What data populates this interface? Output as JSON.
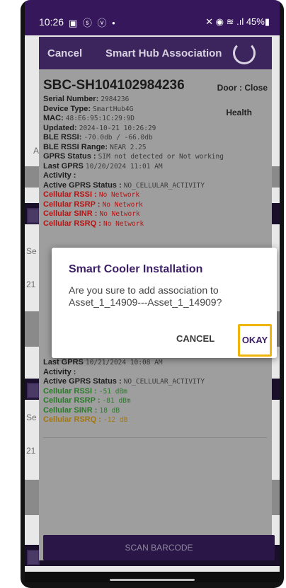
{
  "status_bar": {
    "time": "10:26",
    "notification_icons": "▣ ⓢ ⓥ •",
    "system_icons": "✕ ◉ ≋ .ıl 45%▮"
  },
  "header": {
    "cancel_label": "Cancel",
    "title": "Smart Hub Association"
  },
  "device": {
    "id": "SBC-SH104102984236",
    "door_status": "Door : Close",
    "health_label": "Health",
    "rows": [
      {
        "label": "Serial Number:",
        "value": "2984236",
        "tone": "normal"
      },
      {
        "label": "Device Type:",
        "value": "SmartHub4G",
        "tone": "normal"
      },
      {
        "label": "MAC:",
        "value": "48:E6:95:1C:29:9D",
        "tone": "normal"
      },
      {
        "label": "Updated:",
        "value": "2024-10-21 10:26:29",
        "tone": "normal"
      },
      {
        "label": "BLE RSSI:",
        "value": "-70.0db / -66.0db",
        "tone": "normal"
      },
      {
        "label": "BLE RSSI Range:",
        "value": "NEAR 2.25",
        "tone": "normal"
      },
      {
        "label": "GPRS Status :",
        "value": "SIM not detected or Not working",
        "tone": "normal"
      },
      {
        "label": "Last GPRS",
        "value": "10/20/2024 11:01 AM",
        "tone": "normal"
      },
      {
        "label": "Activity :",
        "value": "",
        "tone": "normal"
      },
      {
        "label": "Active GPRS Status :",
        "value": "NO_CELLULAR_ACTIVITY",
        "tone": "normal"
      },
      {
        "label": "Cellular RSSI :",
        "value": "No Network",
        "tone": "red"
      },
      {
        "label": "Cellular RSRP :",
        "value": "No Network",
        "tone": "red"
      },
      {
        "label": "Cellular SINR :",
        "value": "No Network",
        "tone": "red"
      },
      {
        "label": "Cellular RSRQ :",
        "value": "No Network",
        "tone": "red"
      }
    ]
  },
  "device2": {
    "rows": [
      {
        "label": "Last GPRS",
        "value": "10/21/2024 10:08 AM",
        "tone": "normal"
      },
      {
        "label": "Activity :",
        "value": "",
        "tone": "normal"
      },
      {
        "label": "Active GPRS Status :",
        "value": "NO_CELLULAR_ACTIVITY",
        "tone": "normal"
      },
      {
        "label": "Cellular RSSI :",
        "value": "-51 dBm",
        "tone": "green"
      },
      {
        "label": "Cellular RSRP :",
        "value": "-81 dBm",
        "tone": "green"
      },
      {
        "label": "Cellular SINR :",
        "value": "18 dB",
        "tone": "green"
      },
      {
        "label": "Cellular RSRQ :",
        "value": "-12 dB",
        "tone": "orange"
      }
    ]
  },
  "scan_button_label": "SCAN BARCODE",
  "dialog": {
    "title": "Smart Cooler Installation",
    "message": "Are you sure to add association to Asset_1_14909---Asset_1_14909?",
    "cancel_label": "CANCEL",
    "okay_label": "OKAY"
  },
  "background": {
    "partial_texts": [
      "A",
      "Se",
      "21",
      "Se",
      "21",
      "e"
    ]
  }
}
